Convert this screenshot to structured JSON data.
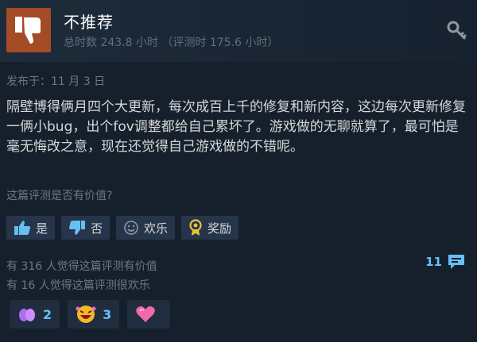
{
  "review": {
    "verdict": "不推荐",
    "hours": "总时数 243.8 小时 （评测时 175.6 小时）",
    "posted": "发布于：11 月 3 日",
    "body": "隔壁博得俩月四个大更新，每次成百上千的修复和新内容，这边每次更新修复一俩小bug，出个fov调整都给自己累坏了。游戏做的无聊就算了，最可怕是毫无悔改之意，现在还觉得自己游戏做的不错呢。"
  },
  "feedback": {
    "question": "这篇评测是否有价值?",
    "yes_label": "是",
    "no_label": "否",
    "funny_label": "欢乐",
    "award_label": "奖励"
  },
  "stats": {
    "helpful": "有 316 人觉得这篇评测有价值",
    "funny": "有 16 人觉得这篇评测很欢乐",
    "comment_count": "11"
  },
  "awards": [
    {
      "icon": "purple-hands-icon",
      "count": "2"
    },
    {
      "icon": "laughing-face-icon",
      "count": "3"
    },
    {
      "icon": "pink-heart-icon",
      "count": ""
    }
  ],
  "colors": {
    "thumb_down_bg": "#a34c25",
    "link_blue": "#66c0f4",
    "button_bg": "#26354a"
  }
}
